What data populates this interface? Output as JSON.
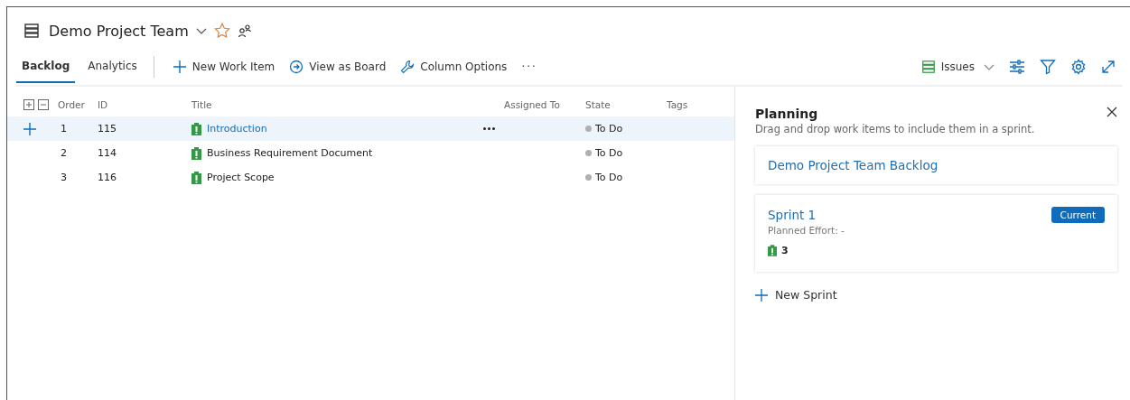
{
  "header": {
    "title": "Demo Project Team"
  },
  "tabs": [
    {
      "label": "Backlog",
      "selected": true
    },
    {
      "label": "Analytics",
      "selected": false
    }
  ],
  "toolbar": [
    {
      "kind": "add",
      "label": "New Work Item"
    },
    {
      "kind": "board",
      "label": "View as Board"
    },
    {
      "kind": "columns",
      "label": "Column Options"
    },
    {
      "kind": "more",
      "label": "···"
    }
  ],
  "work_item_type": {
    "label": "Issues"
  },
  "table": {
    "columns": [
      "Order",
      "ID",
      "Title",
      "Assigned To",
      "State",
      "Tags"
    ],
    "rows": [
      {
        "order": "1",
        "id": "115",
        "title": "Introduction",
        "state": "To Do",
        "selected": true
      },
      {
        "order": "2",
        "id": "114",
        "title": "Business Requirement Document",
        "state": "To Do",
        "selected": false
      },
      {
        "order": "3",
        "id": "116",
        "title": "Project Scope",
        "state": "To Do",
        "selected": false
      }
    ]
  },
  "planning": {
    "title": "Planning",
    "subtitle": "Drag and drop work items to include them in a sprint.",
    "backlog": "Demo Project Team Backlog",
    "sprints": [
      {
        "name": "Sprint 1",
        "badge": "Current",
        "effort": "Planned Effort: -",
        "count": "3"
      }
    ],
    "new_sprint": "New Sprint"
  }
}
